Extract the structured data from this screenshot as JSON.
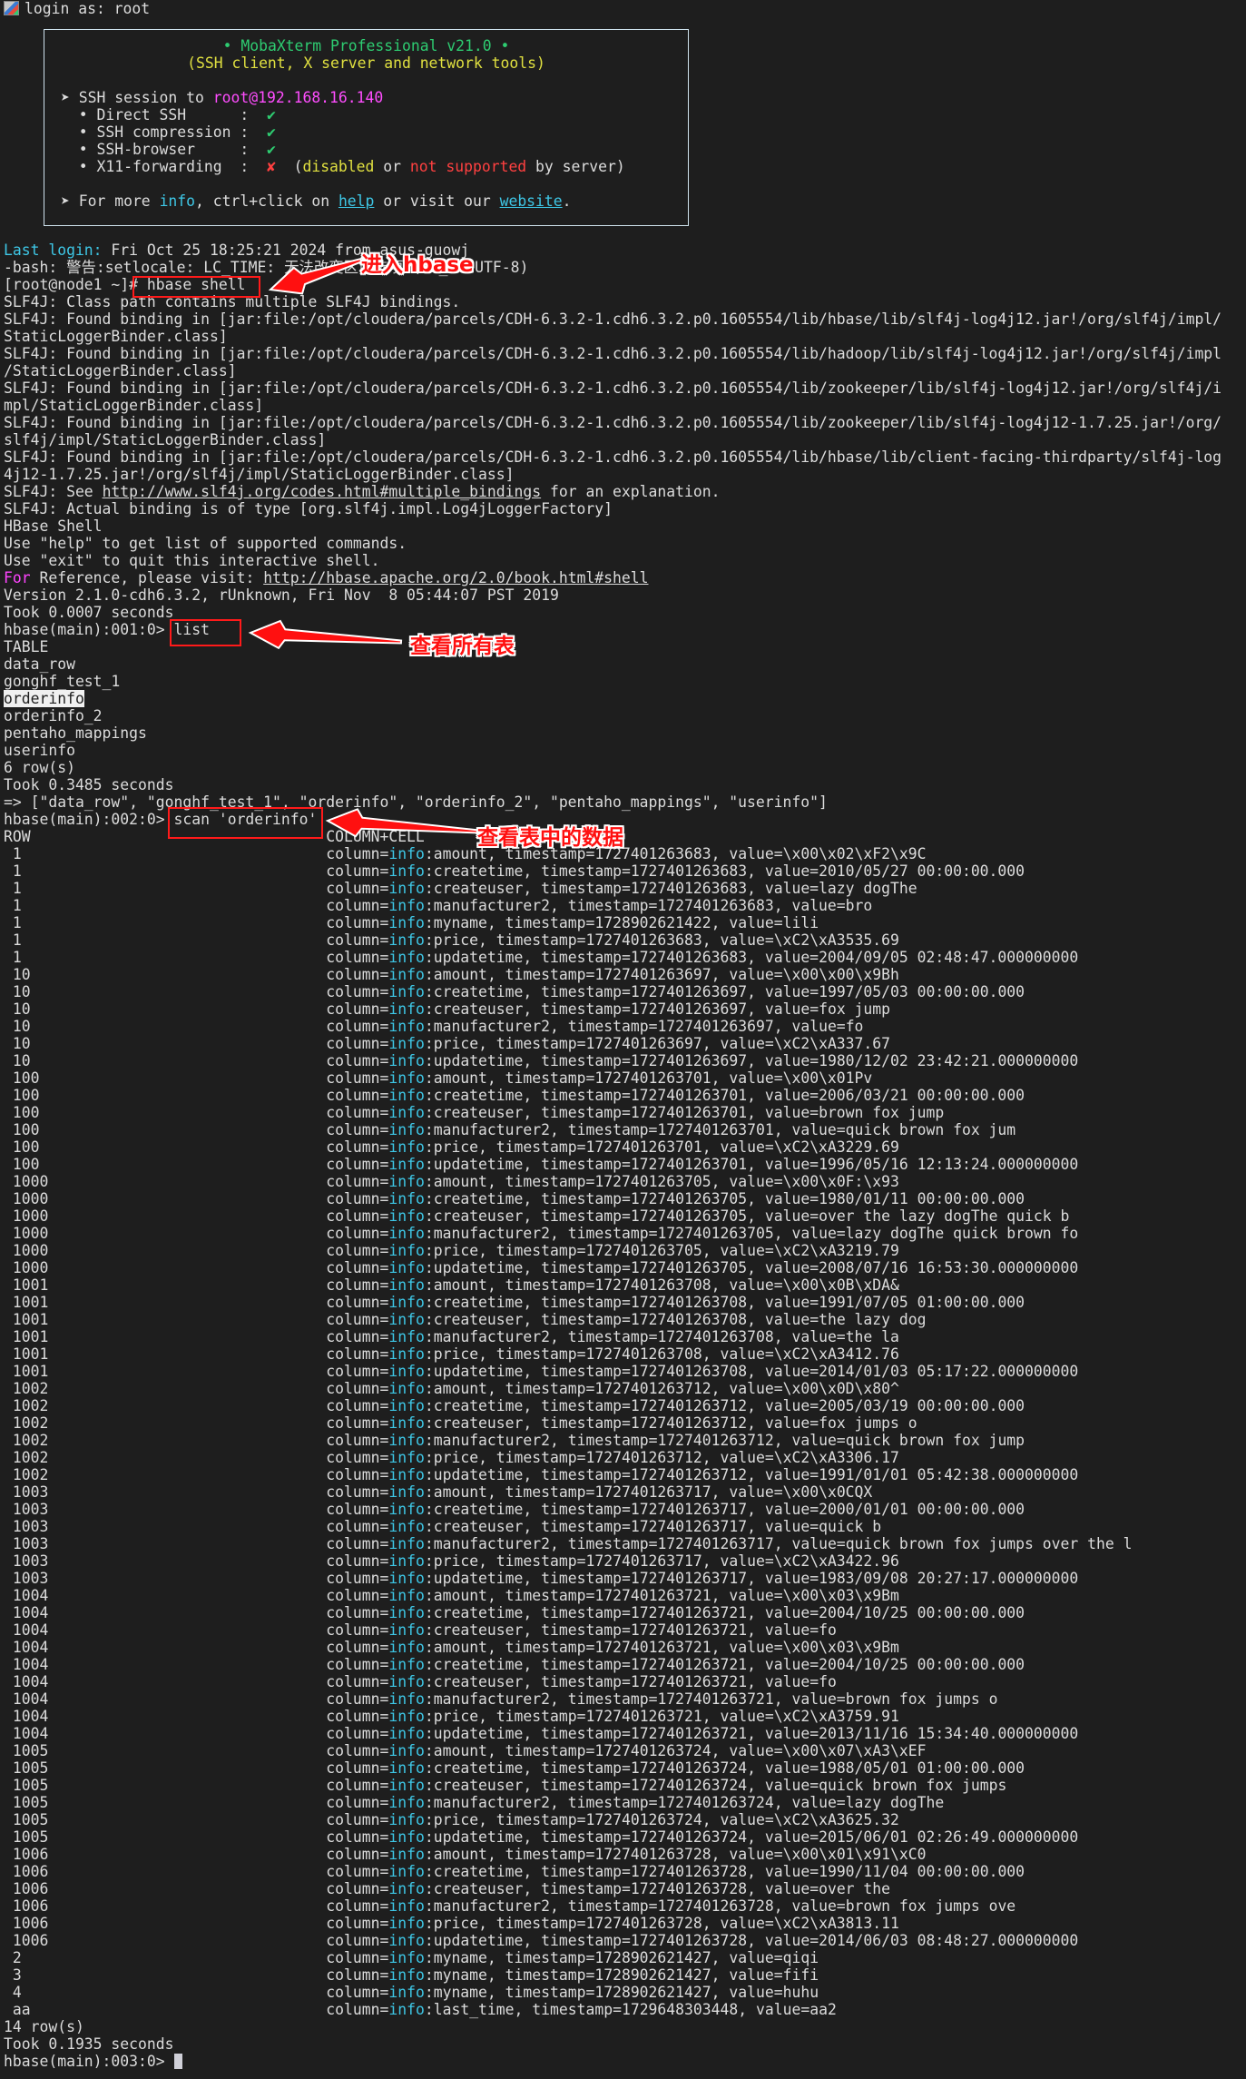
{
  "colors": {
    "fg": "#dcdcdc",
    "cyan": "#3ec7e6",
    "green": "#2ecc71",
    "yellow": "#e0e040",
    "pink": "#ff4dff",
    "red": "#ff4040",
    "magenta": "#ff44ff",
    "annotation": "#ff1010"
  },
  "login_line": "login as: root",
  "header_box": {
    "lines": [
      {
        "center": true,
        "segs": [
          {
            "t": "• MobaXterm Professional v21.0 •",
            "c": "green"
          }
        ]
      },
      {
        "center": true,
        "segs": [
          {
            "t": "(SSH client, X server and network tools)",
            "c": "yellow"
          }
        ]
      },
      {
        "segs": []
      },
      {
        "segs": [
          {
            "t": "➤ SSH session to ",
            "c": "fg"
          },
          {
            "t": "root@192.168.16.140",
            "c": "pink"
          }
        ]
      },
      {
        "segs": [
          {
            "t": "  • Direct SSH      :  ",
            "c": "fg"
          },
          {
            "t": "✔",
            "c": "green"
          }
        ]
      },
      {
        "segs": [
          {
            "t": "  • SSH compression :  ",
            "c": "fg"
          },
          {
            "t": "✔",
            "c": "green"
          }
        ]
      },
      {
        "segs": [
          {
            "t": "  • SSH-browser     :  ",
            "c": "fg"
          },
          {
            "t": "✔",
            "c": "green"
          }
        ]
      },
      {
        "segs": [
          {
            "t": "  • X11-forwarding  :  ",
            "c": "fg"
          },
          {
            "t": "✘",
            "c": "red"
          },
          {
            "t": "  (",
            "c": "fg"
          },
          {
            "t": "disabled",
            "c": "yellow"
          },
          {
            "t": " or ",
            "c": "fg"
          },
          {
            "t": "not supported",
            "c": "red"
          },
          {
            "t": " by server)",
            "c": "fg"
          }
        ]
      },
      {
        "segs": []
      },
      {
        "segs": [
          {
            "t": "➤ For more ",
            "c": "fg"
          },
          {
            "t": "info",
            "c": "cyan"
          },
          {
            "t": ", ctrl+click on ",
            "c": "fg"
          },
          {
            "t": "help",
            "c": "cyan",
            "u": true,
            "link": true
          },
          {
            "t": " or visit our ",
            "c": "fg"
          },
          {
            "t": "website",
            "c": "cyan",
            "u": true,
            "link": true
          },
          {
            "t": ".",
            "c": "fg"
          }
        ]
      }
    ]
  },
  "lines": [
    [
      {
        "t": "Last login:",
        "c": "cyan"
      },
      {
        "t": " Fri Oct 25 18:25:21 2024 from asus-guowj"
      }
    ],
    [
      {
        "t": "-bash: 警告:setlocale: LC_TIME: 无法改变区域选项 (zh_CN.UTF-8)"
      }
    ],
    [
      {
        "t": "[root@node1 ~]# hbase shell"
      }
    ],
    [
      {
        "t": "SLF4J: Class path contains multiple SLF4J bindings."
      }
    ],
    [
      {
        "t": "SLF4J: Found binding in [jar:file:/opt/cloudera/parcels/CDH-6.3.2-1.cdh6.3.2.p0.1605554/lib/hbase/lib/slf4j-log4j12.jar!/org/slf4j/impl/"
      }
    ],
    [
      {
        "t": "StaticLoggerBinder.class]"
      }
    ],
    [
      {
        "t": "SLF4J: Found binding in [jar:file:/opt/cloudera/parcels/CDH-6.3.2-1.cdh6.3.2.p0.1605554/lib/hadoop/lib/slf4j-log4j12.jar!/org/slf4j/impl"
      }
    ],
    [
      {
        "t": "/StaticLoggerBinder.class]"
      }
    ],
    [
      {
        "t": "SLF4J: Found binding in [jar:file:/opt/cloudera/parcels/CDH-6.3.2-1.cdh6.3.2.p0.1605554/lib/zookeeper/lib/slf4j-log4j12.jar!/org/slf4j/i"
      }
    ],
    [
      {
        "t": "mpl/StaticLoggerBinder.class]"
      }
    ],
    [
      {
        "t": "SLF4J: Found binding in [jar:file:/opt/cloudera/parcels/CDH-6.3.2-1.cdh6.3.2.p0.1605554/lib/zookeeper/lib/slf4j-log4j12-1.7.25.jar!/org/"
      }
    ],
    [
      {
        "t": "slf4j/impl/StaticLoggerBinder.class]"
      }
    ],
    [
      {
        "t": "SLF4J: Found binding in [jar:file:/opt/cloudera/parcels/CDH-6.3.2-1.cdh6.3.2.p0.1605554/lib/hbase/lib/client-facing-thirdparty/slf4j-log"
      }
    ],
    [
      {
        "t": "4j12-1.7.25.jar!/org/slf4j/impl/StaticLoggerBinder.class]"
      }
    ],
    [
      {
        "t": "SLF4J: See "
      },
      {
        "t": "http://www.slf4j.org/codes.html#multiple_bindings",
        "u": true,
        "link": true
      },
      {
        "t": " for an explanation."
      }
    ],
    [
      {
        "t": "SLF4J: Actual binding is of type [org.slf4j.impl.Log4jLoggerFactory]"
      }
    ],
    [
      {
        "t": "HBase Shell"
      }
    ],
    [
      {
        "t": "Use \"help\" to get list of supported commands."
      }
    ],
    [
      {
        "t": "Use \"exit\" to quit this interactive shell."
      }
    ],
    [
      {
        "t": "For",
        "c": "magenta"
      },
      {
        "t": " Reference, please visit: "
      },
      {
        "t": "http://hbase.apache.org/2.0/book.html#shell",
        "u": true,
        "link": true
      }
    ],
    [
      {
        "t": "Version 2.1.0-cdh6.3.2, rUnknown, Fri Nov  8 05:44:07 PST 2019"
      }
    ],
    [
      {
        "t": "Took 0.0007 seconds"
      }
    ],
    [
      {
        "t": "hbase(main):001:0> list"
      }
    ],
    [
      {
        "t": "TABLE"
      }
    ],
    [
      {
        "t": "data_row"
      }
    ],
    [
      {
        "t": "gonghf_test_1"
      }
    ],
    [
      {
        "t": "orderinfo",
        "sel": true
      }
    ],
    [
      {
        "t": "orderinfo_2"
      }
    ],
    [
      {
        "t": "pentaho_mappings"
      }
    ],
    [
      {
        "t": "userinfo"
      }
    ],
    [
      {
        "t": "6 row(s)"
      }
    ],
    [
      {
        "t": "Took 0.3485 seconds"
      }
    ],
    [
      {
        "t": "=> [\"data_row\", \"gonghf_test_1\", \"orderinfo\", \"orderinfo_2\", \"pentaho_mappings\", \"userinfo\"]"
      }
    ],
    [
      {
        "t": "hbase(main):002:0> scan 'orderinfo'"
      }
    ]
  ],
  "scan": {
    "header_row": "ROW",
    "header_cell": "COLUMN+CELL",
    "family": "info",
    "cells": [
      [
        "1",
        "amount",
        "1727401263683",
        "\\x00\\x02\\xF2\\x9C"
      ],
      [
        "1",
        "createtime",
        "1727401263683",
        "2010/05/27 00:00:00.000"
      ],
      [
        "1",
        "createuser",
        "1727401263683",
        "lazy dogThe"
      ],
      [
        "1",
        "manufacturer2",
        "1727401263683",
        "bro"
      ],
      [
        "1",
        "myname",
        "1728902621422",
        "lili"
      ],
      [
        "1",
        "price",
        "1727401263683",
        "\\xC2\\xA3535.69"
      ],
      [
        "1",
        "updatetime",
        "1727401263683",
        "2004/09/05 02:48:47.000000000"
      ],
      [
        "10",
        "amount",
        "1727401263697",
        "\\x00\\x00\\x9Bh"
      ],
      [
        "10",
        "createtime",
        "1727401263697",
        "1997/05/03 00:00:00.000"
      ],
      [
        "10",
        "createuser",
        "1727401263697",
        "fox jump"
      ],
      [
        "10",
        "manufacturer2",
        "1727401263697",
        "fo"
      ],
      [
        "10",
        "price",
        "1727401263697",
        "\\xC2\\xA337.67"
      ],
      [
        "10",
        "updatetime",
        "1727401263697",
        "1980/12/02 23:42:21.000000000"
      ],
      [
        "100",
        "amount",
        "1727401263701",
        "\\x00\\x01Pv"
      ],
      [
        "100",
        "createtime",
        "1727401263701",
        "2006/03/21 00:00:00.000"
      ],
      [
        "100",
        "createuser",
        "1727401263701",
        "brown fox jump"
      ],
      [
        "100",
        "manufacturer2",
        "1727401263701",
        "quick brown fox jum"
      ],
      [
        "100",
        "price",
        "1727401263701",
        "\\xC2\\xA3229.69"
      ],
      [
        "100",
        "updatetime",
        "1727401263701",
        "1996/05/16 12:13:24.000000000"
      ],
      [
        "1000",
        "amount",
        "1727401263705",
        "\\x00\\x0F:\\x93"
      ],
      [
        "1000",
        "createtime",
        "1727401263705",
        "1980/01/11 00:00:00.000"
      ],
      [
        "1000",
        "createuser",
        "1727401263705",
        "over the lazy dogThe quick b"
      ],
      [
        "1000",
        "manufacturer2",
        "1727401263705",
        "lazy dogThe quick brown fo"
      ],
      [
        "1000",
        "price",
        "1727401263705",
        "\\xC2\\xA3219.79"
      ],
      [
        "1000",
        "updatetime",
        "1727401263705",
        "2008/07/16 16:53:30.000000000"
      ],
      [
        "1001",
        "amount",
        "1727401263708",
        "\\x00\\x0B\\xDA&"
      ],
      [
        "1001",
        "createtime",
        "1727401263708",
        "1991/07/05 01:00:00.000"
      ],
      [
        "1001",
        "createuser",
        "1727401263708",
        "the lazy dog"
      ],
      [
        "1001",
        "manufacturer2",
        "1727401263708",
        "the la"
      ],
      [
        "1001",
        "price",
        "1727401263708",
        "\\xC2\\xA3412.76"
      ],
      [
        "1001",
        "updatetime",
        "1727401263708",
        "2014/01/03 05:17:22.000000000"
      ],
      [
        "1002",
        "amount",
        "1727401263712",
        "\\x00\\x0D\\x80^"
      ],
      [
        "1002",
        "createtime",
        "1727401263712",
        "2005/03/19 00:00:00.000"
      ],
      [
        "1002",
        "createuser",
        "1727401263712",
        "fox jumps o"
      ],
      [
        "1002",
        "manufacturer2",
        "1727401263712",
        "quick brown fox jump"
      ],
      [
        "1002",
        "price",
        "1727401263712",
        "\\xC2\\xA3306.17"
      ],
      [
        "1002",
        "updatetime",
        "1727401263712",
        "1991/01/01 05:42:38.000000000"
      ],
      [
        "1003",
        "amount",
        "1727401263717",
        "\\x00\\x0CQX"
      ],
      [
        "1003",
        "createtime",
        "1727401263717",
        "2000/01/01 00:00:00.000"
      ],
      [
        "1003",
        "createuser",
        "1727401263717",
        "quick b"
      ],
      [
        "1003",
        "manufacturer2",
        "1727401263717",
        "quick brown fox jumps over the l"
      ],
      [
        "1003",
        "price",
        "1727401263717",
        "\\xC2\\xA3422.96"
      ],
      [
        "1003",
        "updatetime",
        "1727401263717",
        "1983/09/08 20:27:17.000000000"
      ],
      [
        "1004",
        "amount",
        "1727401263721",
        "\\x00\\x03\\x9Bm"
      ],
      [
        "1004",
        "createtime",
        "1727401263721",
        "2004/10/25 00:00:00.000"
      ],
      [
        "1004",
        "createuser",
        "1727401263721",
        "fo"
      ],
      [
        "1004",
        "amount",
        "1727401263721",
        "\\x00\\x03\\x9Bm"
      ],
      [
        "1004",
        "createtime",
        "1727401263721",
        "2004/10/25 00:00:00.000"
      ],
      [
        "1004",
        "createuser",
        "1727401263721",
        "fo"
      ],
      [
        "1004",
        "manufacturer2",
        "1727401263721",
        "brown fox jumps o"
      ],
      [
        "1004",
        "price",
        "1727401263721",
        "\\xC2\\xA3759.91"
      ],
      [
        "1004",
        "updatetime",
        "1727401263721",
        "2013/11/16 15:34:40.000000000"
      ],
      [
        "1005",
        "amount",
        "1727401263724",
        "\\x00\\x07\\xA3\\xEF"
      ],
      [
        "1005",
        "createtime",
        "1727401263724",
        "1988/05/01 01:00:00.000"
      ],
      [
        "1005",
        "createuser",
        "1727401263724",
        "quick brown fox jumps"
      ],
      [
        "1005",
        "manufacturer2",
        "1727401263724",
        "lazy dogThe"
      ],
      [
        "1005",
        "price",
        "1727401263724",
        "\\xC2\\xA3625.32"
      ],
      [
        "1005",
        "updatetime",
        "1727401263724",
        "2015/06/01 02:26:49.000000000"
      ],
      [
        "1006",
        "amount",
        "1727401263728",
        "\\x00\\x01\\x91\\xC0"
      ],
      [
        "1006",
        "createtime",
        "1727401263728",
        "1990/11/04 00:00:00.000"
      ],
      [
        "1006",
        "createuser",
        "1727401263728",
        "over the"
      ],
      [
        "1006",
        "manufacturer2",
        "1727401263728",
        "brown fox jumps ove"
      ],
      [
        "1006",
        "price",
        "1727401263728",
        "\\xC2\\xA3813.11"
      ],
      [
        "1006",
        "updatetime",
        "1727401263728",
        "2014/06/03 08:48:27.000000000"
      ],
      [
        "2",
        "myname",
        "1728902621427",
        "qiqi"
      ],
      [
        "3",
        "myname",
        "1728902621427",
        "fifi"
      ],
      [
        "4",
        "myname",
        "1728902621427",
        "huhu"
      ],
      [
        "aa",
        "last_time",
        "1729648303448",
        "aa2"
      ]
    ],
    "row_count": "14 row(s)",
    "took": "Took 0.1935 seconds"
  },
  "final_prompt": "hbase(main):003:0> ",
  "annotations": {
    "enter_hbase": "进入hbase",
    "list_tables": "查看所有表",
    "view_table_data": "查看表中的数据"
  }
}
